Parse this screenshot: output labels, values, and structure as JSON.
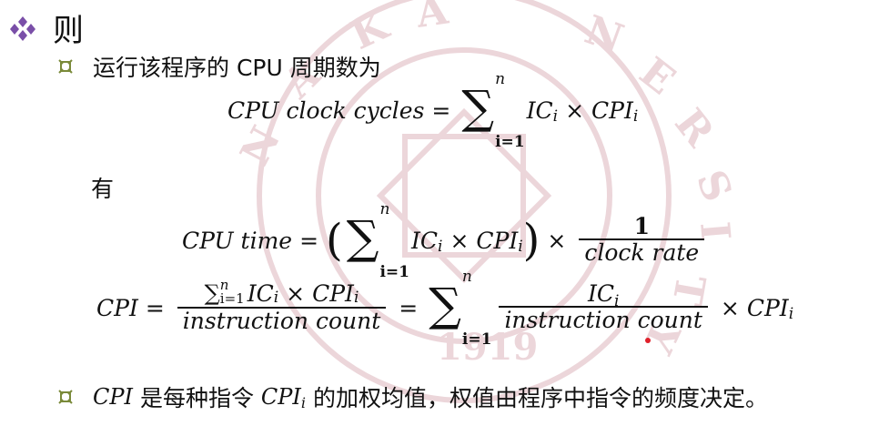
{
  "heading": "则",
  "bullet1": "运行该程序的 CPU 周期数为",
  "you": "有",
  "bullet2": {
    "part1": "CPI",
    "part2": " 是每种指令 ",
    "part3": "CPI",
    "part3_sub": "i",
    "part4": " 的加权均值，权值由程序中指令的频度决定。"
  },
  "eq1": {
    "lhs": "CPU clock cycles",
    "eq": "=",
    "sum_top": "n",
    "sum_bot": "i=1",
    "ic": "IC",
    "sub_i": "i",
    "times": "×",
    "cpi": "CPI"
  },
  "eq2": {
    "lhs": "CPU time",
    "eq": "=",
    "lparen": "(",
    "rparen": ")",
    "sum_top": "n",
    "sum_bot": "i=1",
    "ic": "IC",
    "sub_i": "i",
    "times": "×",
    "cpi": "CPI",
    "frac_num": "1",
    "frac_den": "clock rate"
  },
  "eq3": {
    "lhs": "CPI",
    "eq": "=",
    "num_sum_top": "n",
    "num_sum_bot": "i=1",
    "num_ic": "IC",
    "num_times": "×",
    "num_cpi": "CPI",
    "sub_i": "i",
    "den": "instruction count",
    "eq2": "=",
    "sum_top": "n",
    "sum_bot": "i=1",
    "frac_num": "IC",
    "frac_den": "instruction count",
    "times": "×",
    "cpi": "CPI"
  },
  "colors": {
    "diamond": "#7a4fa8",
    "bullet": "#7a8a3a",
    "watermark": "#e8cfd4"
  },
  "icons": {
    "heading_marker": "diamond-cluster-icon",
    "bullet_marker": "square-bullet-icon"
  }
}
